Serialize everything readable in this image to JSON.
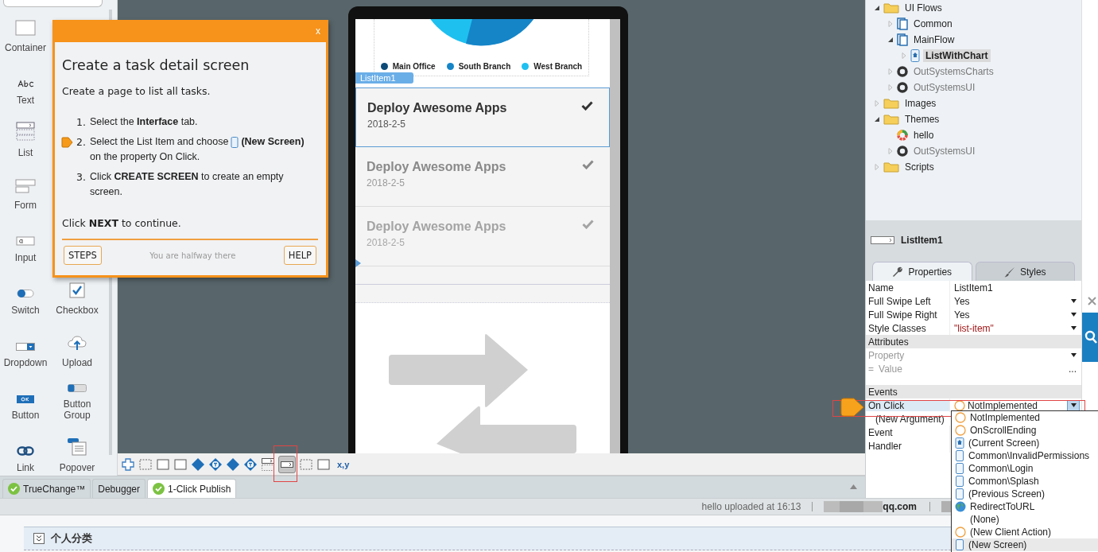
{
  "palette": {
    "column_1": [
      {
        "label": "Container",
        "kind": "container"
      },
      {
        "label": "Text",
        "kind": "text"
      },
      {
        "label": "List",
        "kind": "list"
      },
      {
        "label": "Form",
        "kind": "form"
      },
      {
        "label": "Input",
        "kind": "input"
      },
      {
        "label": "Switch",
        "kind": "switch"
      },
      {
        "label": "Dropdown",
        "kind": "dropdown"
      },
      {
        "label": "Button",
        "kind": "button"
      },
      {
        "label": "Link",
        "kind": "link"
      }
    ],
    "column_2": [
      {
        "label": "Checkbox",
        "kind": "checkbox"
      },
      {
        "label": "Upload",
        "kind": "upload"
      },
      {
        "label": "Button Group",
        "kind": "button-group"
      },
      {
        "label": "Popover",
        "kind": "popover"
      }
    ]
  },
  "tutorial": {
    "close": "x",
    "title": "Create a task detail screen",
    "intro": "Create a page to list all tasks.",
    "steps": [
      {
        "number": "1.",
        "parts": [
          "Select the **Interface** tab."
        ],
        "pointer": false
      },
      {
        "number": "2.",
        "parts": [
          "Select the List Item and choose",
          "**(New Screen)**",
          "on the property On Click."
        ],
        "pointer": true
      },
      {
        "number": "3.",
        "parts": [
          "Click **CREATE SCREEN** to create an empty screen."
        ],
        "pointer": false
      }
    ],
    "next_hint": "Click **NEXT** to continue.",
    "steps_button": "STEPS",
    "progress": "You are halfway there",
    "help_button": "HELP"
  },
  "phone": {
    "legend": [
      {
        "label": "Main Office",
        "color": "#0d4a78"
      },
      {
        "label": "South Branch",
        "color": "#1585c8"
      },
      {
        "label": "West Branch",
        "color": "#1ec0f0"
      }
    ],
    "widget_tag": "ListItem1",
    "list_items": [
      {
        "title": "Deploy Awesome Apps",
        "date": "2018-2-5",
        "kind": "strong",
        "selected": true
      },
      {
        "title": "Deploy Awesome Apps",
        "date": "2018-2-5",
        "kind": "medium",
        "selected": false
      },
      {
        "title": "Deploy Awesome Apps",
        "date": "2018-2-5",
        "kind": "faint",
        "selected": false
      }
    ]
  },
  "toolbar": {
    "tools": [
      {
        "kind": "puzzle",
        "selected": false
      },
      {
        "kind": "dashed",
        "selected": false
      },
      {
        "kind": "rect",
        "selected": false
      },
      {
        "kind": "rect",
        "selected": false
      },
      {
        "kind": "diamond",
        "selected": false
      },
      {
        "kind": "diamond-t",
        "selected": false
      },
      {
        "kind": "diamond",
        "selected": false
      },
      {
        "kind": "diamond-t",
        "selected": false
      },
      {
        "kind": "list",
        "selected": false
      },
      {
        "kind": "list-item",
        "selected": true
      },
      {
        "kind": "dashed",
        "selected": false
      },
      {
        "kind": "rect",
        "selected": false
      }
    ],
    "coords": "x,y"
  },
  "tree": [
    {
      "label": "UI Flows",
      "kind": "folder",
      "expanded": true,
      "children": [
        {
          "label": "Common",
          "kind": "flow",
          "expanded": false
        },
        {
          "label": "MainFlow",
          "kind": "flow",
          "expanded": true,
          "children": [
            {
              "label": "ListWithChart",
              "kind": "screen",
              "expanded": false,
              "selected": true
            }
          ]
        },
        {
          "label": "OutSystemsCharts",
          "kind": "module",
          "expanded": false
        },
        {
          "label": "OutSystemsUI",
          "kind": "module",
          "expanded": false
        }
      ]
    },
    {
      "label": "Images",
      "kind": "folder",
      "expanded": false
    },
    {
      "label": "Themes",
      "kind": "folder",
      "expanded": true,
      "children": [
        {
          "label": "hello",
          "kind": "theme"
        },
        {
          "label": "OutSystemsUI",
          "kind": "module",
          "expanded": false
        }
      ]
    },
    {
      "label": "Scripts",
      "kind": "folder",
      "expanded": false
    }
  ],
  "properties": {
    "element_name": "ListItem1",
    "tabs": [
      {
        "label": "Properties",
        "kind": "wrench",
        "selected": true
      },
      {
        "label": "Styles",
        "kind": "brush",
        "selected": false
      }
    ],
    "rows": [
      {
        "kind": "text",
        "name": "Name",
        "value": "ListItem1"
      },
      {
        "kind": "select",
        "name": "Full Swipe Left",
        "value": "Yes"
      },
      {
        "kind": "select",
        "name": "Full Swipe Right",
        "value": "Yes"
      },
      {
        "kind": "expression",
        "name": "Style Classes",
        "value": "\"list-item\""
      }
    ],
    "attributes": {
      "title": "Attributes",
      "property_placeholder": "Property",
      "value_prefix": "=",
      "value_placeholder": "Value",
      "more": "..."
    },
    "events": {
      "title": "Events",
      "on_click": {
        "name": "On Click",
        "value": "NotImplemented",
        "expanded": true,
        "highlighted": true
      },
      "argument": "(New Argument)",
      "extra_rows": [
        "Event",
        "Handler"
      ]
    }
  },
  "dropdown_options": [
    {
      "label": "NotImplemented",
      "kind": "action",
      "selected": false
    },
    {
      "label": "OnScrollEnding",
      "kind": "action",
      "selected": false
    },
    {
      "label": "(Current Screen)",
      "kind": "current-screen",
      "selected": false
    },
    {
      "label": "Common\\InvalidPermissions",
      "kind": "screen",
      "selected": false
    },
    {
      "label": "Common\\Login",
      "kind": "screen",
      "selected": false
    },
    {
      "label": "Common\\Splash",
      "kind": "screen",
      "selected": false
    },
    {
      "label": "(Previous Screen)",
      "kind": "screen",
      "selected": false
    },
    {
      "label": "RedirectToURL",
      "kind": "globe",
      "selected": false
    },
    {
      "label": "(None)",
      "kind": "none",
      "selected": false
    },
    {
      "label": "(New Client Action)",
      "kind": "action",
      "selected": false
    },
    {
      "label": "(New Screen)",
      "kind": "screen",
      "selected": true
    }
  ],
  "bottom_tabs": [
    {
      "label": "TrueChange™",
      "ok": true,
      "selected": false
    },
    {
      "label": "Debugger",
      "ok": false,
      "selected": false
    },
    {
      "label": "1-Click Publish",
      "ok": true,
      "selected": true
    }
  ],
  "status_bar": {
    "message": "hello uploaded at 16:13",
    "account": "qq.com"
  },
  "web_section": {
    "title": "个人分类"
  }
}
